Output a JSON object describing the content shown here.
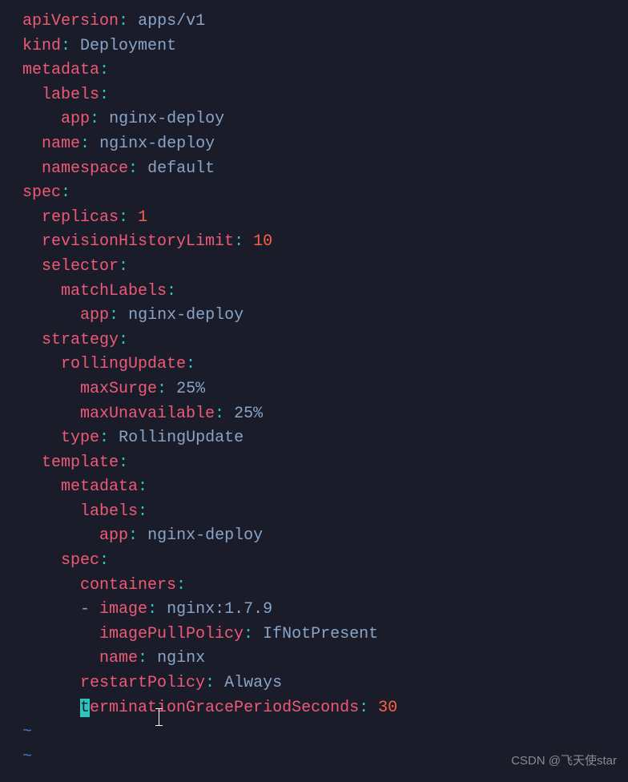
{
  "lines": {
    "l1_k1": "apiVersion",
    "l1_v1": "apps/v1",
    "l2_k1": "kind",
    "l2_v1": "Deployment",
    "l3_k1": "metadata",
    "l4_k1": "labels",
    "l5_k1": "app",
    "l5_v1": "nginx-deploy",
    "l6_k1": "name",
    "l6_v1": "nginx-deploy",
    "l7_k1": "namespace",
    "l7_v1": "default",
    "l8_k1": "spec",
    "l9_k1": "replicas",
    "l9_v1": "1",
    "l10_k1": "revisionHistoryLimit",
    "l10_v1": "10",
    "l11_k1": "selector",
    "l12_k1": "matchLabels",
    "l13_k1": "app",
    "l13_v1": "nginx-deploy",
    "l14_k1": "strategy",
    "l15_k1": "rollingUpdate",
    "l16_k1": "maxSurge",
    "l16_v1": "25%",
    "l17_k1": "maxUnavailable",
    "l17_v1": "25%",
    "l18_k1": "type",
    "l18_v1": "RollingUpdate",
    "l19_k1": "template",
    "l20_k1": "metadata",
    "l21_k1": "labels",
    "l22_k1": "app",
    "l22_v1": "nginx-deploy",
    "l23_k1": "spec",
    "l24_k1": "containers",
    "l25_d": "-",
    "l25_k1": "image",
    "l25_v1": "nginx:1.7.9",
    "l26_k1": "imagePullPolicy",
    "l26_v1": "IfNotPresent",
    "l27_k1": "name",
    "l27_v1": "nginx",
    "l28_k1": "restartPolicy",
    "l28_v1": "Always",
    "l29_cur": "t",
    "l29_k1": "erminationGracePeriodSeconds",
    "l29_v1": "30",
    "tilde": "~"
  },
  "watermark": "CSDN @飞天使star"
}
